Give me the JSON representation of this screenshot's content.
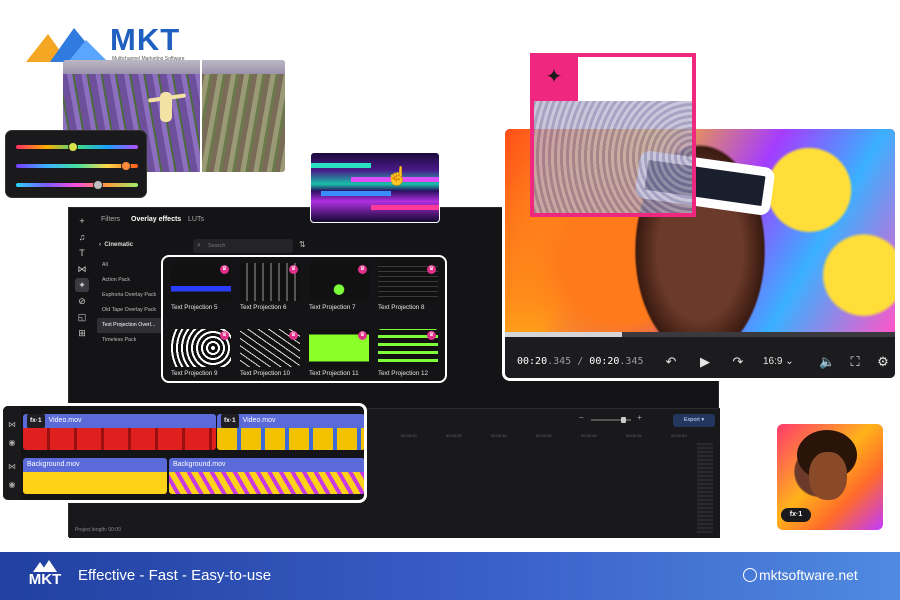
{
  "logo": {
    "text": "MKT",
    "subtitle": "Multichannel Marketing Software"
  },
  "editor": {
    "tabs": [
      "Filters",
      "Overlay effects",
      "LUTs"
    ],
    "active_tab": "Overlay effects",
    "category_header": "Cinematic",
    "categories": [
      "All",
      "Action Pack",
      "Euphoria Overlay Pack",
      "Old Tape Overlay Pack",
      "Text Projection Overl...",
      "Timeless Pack"
    ],
    "active_category": "Text Projection Overl...",
    "search_placeholder": "Search",
    "effects": [
      "Text Projection 5",
      "Text Projection 6",
      "Text Projection 7",
      "Text Projection 8",
      "Text Projection 9",
      "Text Projection 10",
      "Text Projection 11",
      "Text Projection 12"
    ],
    "export_label": "Export",
    "project_length": "Project length: 00:00",
    "ruler": [
      "00:00:20",
      "00:00:25",
      "00:00:30",
      "00:00:35",
      "00:00:40",
      "00:00:45",
      "00:00:50",
      "00:00:55"
    ]
  },
  "preview": {
    "current_time": "00:20",
    "current_ms": ".345",
    "total_time": "00:20",
    "total_ms": ".345",
    "aspect_ratio": "16:9",
    "progress": 0.3
  },
  "timeline": {
    "video_clips": [
      {
        "fx": "fx·1",
        "name": "Video.mov"
      },
      {
        "fx": "fx·1",
        "name": "Video.mov"
      }
    ],
    "bg_clips": [
      {
        "name": "Background.mov"
      },
      {
        "name": "Background.mov"
      }
    ]
  },
  "portrait_badge": "fx·1",
  "footer": {
    "logo_text": "MKT",
    "tagline": "Effective - Fast - Easy-to-use",
    "site": "mktsoftware.net"
  },
  "colors": {
    "accent_pink": "#f0277e",
    "brand_blue": "#1f5fbf",
    "clip_blue": "#5a6ad8",
    "bg_yellow": "#ffd21a"
  }
}
